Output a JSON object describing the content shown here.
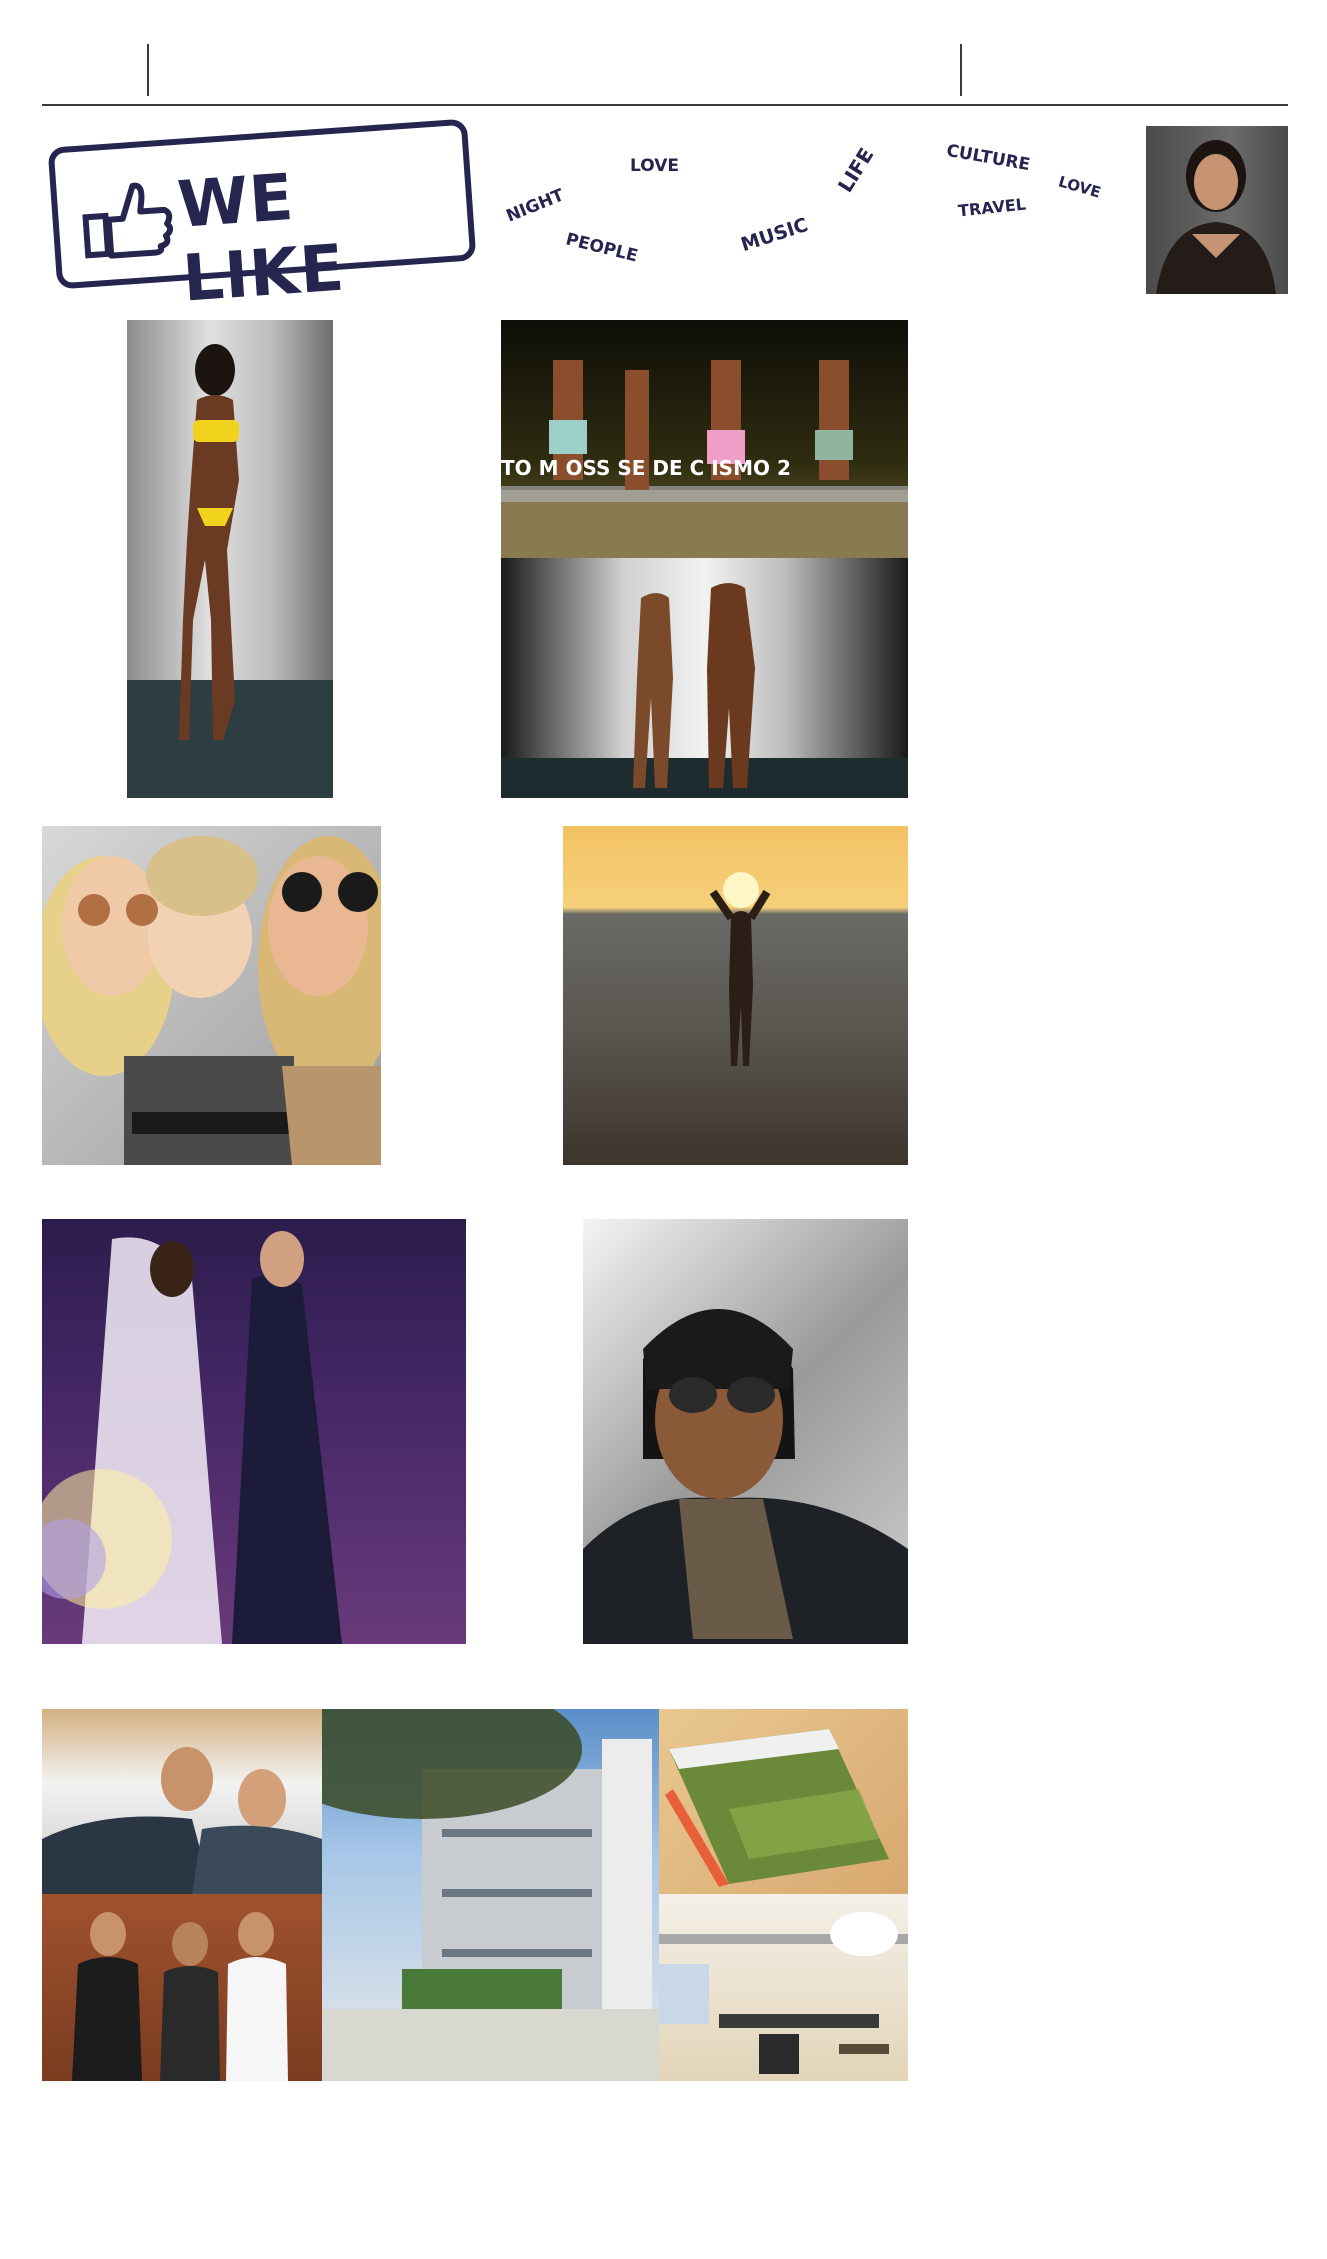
{
  "header": {},
  "banner": {
    "stamp_text": "WE LIKE",
    "stamp_icon": "thumbs-up-icon",
    "brand_color": "#25254f",
    "words": {
      "night": "NIGHT",
      "love1": "LOVE",
      "people": "PEOPLE",
      "music": "MUSIC",
      "life": "LIFE",
      "culture": "CULTURE",
      "travel": "TRAVEL",
      "love2": "LOVE"
    },
    "stage_banner_text": "TO M  OSS  SE DE C   ISMO 2"
  }
}
